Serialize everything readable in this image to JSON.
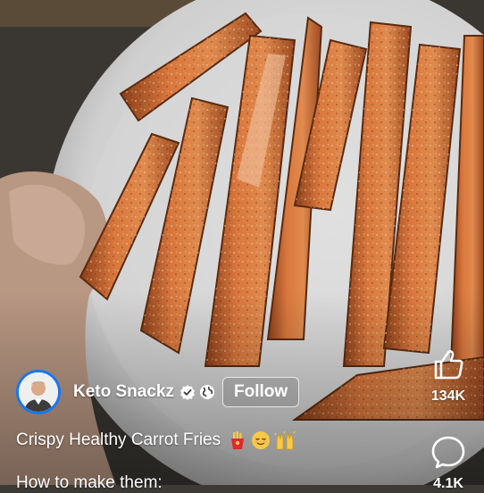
{
  "post": {
    "author_name": "Keto Snackz",
    "follow_label": "Follow",
    "caption": "Crispy Healthy Carrot Fries",
    "caption_emojis": [
      "fries-emoji",
      "relieved-face-emoji",
      "raised-hands-emoji"
    ],
    "description_preview": "How to make them:"
  },
  "actions": {
    "like_count": "134K",
    "comment_count": "4.1K"
  },
  "icons": {
    "verified": "verified-badge-icon",
    "audience": "globe-icon",
    "like": "thumbs-up-icon",
    "comment": "comment-bubble-icon"
  },
  "colors": {
    "avatar_ring": "#1877f2",
    "text": "#ffffff",
    "plate": "#dcdcdc",
    "carrot": "#d7703a"
  }
}
